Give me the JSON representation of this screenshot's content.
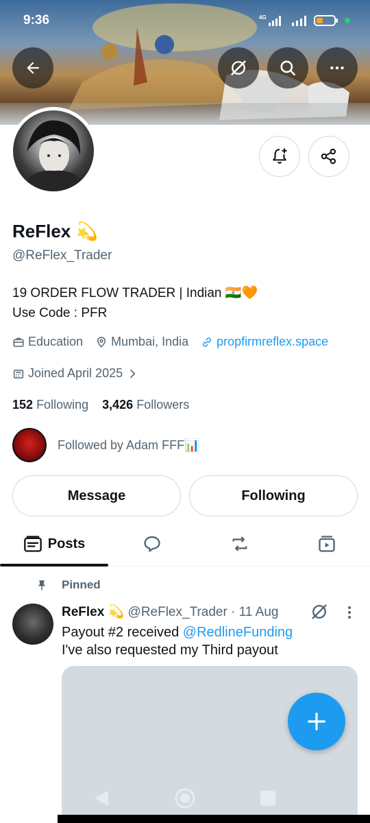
{
  "status_bar": {
    "time": "9:36",
    "network": "4G"
  },
  "banner": {
    "image": "chariot-painting"
  },
  "top_actions": {
    "back_icon": "arrow-left-icon",
    "grok_icon": "grok-icon",
    "search_icon": "search-icon",
    "more_icon": "more-horizontal-icon"
  },
  "profile": {
    "name": "ReFlex 💫",
    "handle": "@ReFlex_Trader",
    "bio_line1": "19 ORDER FLOW TRADER | Indian 🇮🇳🧡",
    "bio_line2": "Use Code : PFR",
    "category": "Education",
    "location": "Mumbai, India",
    "website": "propfirmreflex.space",
    "joined": "Joined April 2025",
    "following_count": "152",
    "following_label": "Following",
    "followers_count": "3,426",
    "followers_label": "Followers",
    "followed_by": "Followed by Adam FFF📊"
  },
  "actions": {
    "message_label": "Message",
    "following_label": "Following"
  },
  "tabs": {
    "posts_label": "Posts"
  },
  "pinned_post": {
    "pinned_label": "Pinned",
    "author_name": "ReFlex 💫",
    "author_handle": "@ReFlex_Trader",
    "separator": " · ",
    "date": "11 Aug",
    "text_prefix": "Payout #2 received ",
    "mention": "@RedlineFunding",
    "text_line2": "I've also requested my Third payout"
  },
  "colors": {
    "accent": "#1d9bf0",
    "text_primary": "#0f1419",
    "text_secondary": "#536471",
    "border": "#cfd9de"
  }
}
